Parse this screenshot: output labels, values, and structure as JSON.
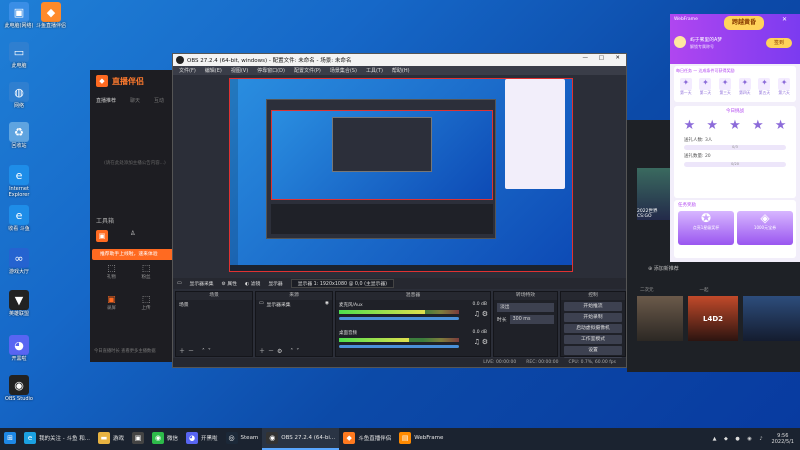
{
  "desktop_icons": [
    {
      "label": "此电脑(网络)",
      "icon": "computer-icon",
      "color": "#3a8ee6",
      "glyph": "▣"
    },
    {
      "label": "斗鱼直播伴侣",
      "icon": "app-icon",
      "color": "#ff8a2a",
      "glyph": "◆"
    },
    {
      "label": "此电脑",
      "icon": "computer-icon",
      "color": "#2f7fd0",
      "glyph": "▭"
    },
    {
      "label": "网络",
      "icon": "network-icon",
      "color": "#2f7fd0",
      "glyph": "◍"
    },
    {
      "label": "回收站",
      "icon": "recycle-bin-icon",
      "color": "#5fa4e0",
      "glyph": "♻"
    },
    {
      "label": "Internet Explorer",
      "icon": "ie-icon",
      "color": "#1e8de8",
      "glyph": "e"
    },
    {
      "label": "收看 斗鱼",
      "icon": "ie-icon",
      "color": "#1e8de8",
      "glyph": "e"
    },
    {
      "label": "游戏大厅",
      "icon": "meta-icon",
      "color": "#2563d0",
      "glyph": "∞"
    },
    {
      "label": "英雄联盟",
      "icon": "game-icon",
      "color": "#222222",
      "glyph": "▼"
    },
    {
      "label": "开黑啦",
      "icon": "discord-icon",
      "color": "#5865f2",
      "glyph": "◕"
    },
    {
      "label": "OBS Studio",
      "icon": "obs-icon",
      "color": "#222222",
      "glyph": "◉"
    }
  ],
  "live_app": {
    "brand": "直播伴侣",
    "tabs": [
      "直播推荐",
      "聊天",
      "互动"
    ],
    "notice": "(请在此处添加主播公告内容...)",
    "tools_label": "工具箱",
    "hint": "推荐助手上线啦，速来体验",
    "tool_rows": [
      [
        "礼物",
        "粉丝",
        "管理"
      ],
      [
        "录屏",
        "上传",
        "更多"
      ]
    ],
    "bottom_tools": [
      "助播",
      "弹幕",
      "连麦"
    ],
    "footer": "今日直播时长  查看更多主播数据"
  },
  "webframe": {
    "title": "WebFrame",
    "tab_icon": "跨越黄昏",
    "streamer": "屿于雾里的A梦",
    "sub": "解锁专属称号",
    "checkin": "签到",
    "progress_label": "每日任务 — 达成条件可获得奖励",
    "days": [
      "第一天",
      "第二天",
      "第三天",
      "第四天",
      "第五天",
      "第六天"
    ],
    "section2": "今日挑战",
    "task1": "送礼人数: 3人",
    "task1_progress": "0/3",
    "task2": "送礼数量: 20",
    "task2_progress": "0/20",
    "gift_label": "任务奖励",
    "reward1": "点亮1星级奖杯",
    "reward2": "1000元宝券",
    "bottom_games": [
      "二次元",
      "一起"
    ],
    "add_banner": "添加新推荐",
    "game_card": "2022世界 CS:GO"
  },
  "obs": {
    "title": "OBS 27.2.4 (64-bit, windows) - 配置文件: 未命名 - 场景: 未命名",
    "menu": [
      "文件(F)",
      "编辑(E)",
      "视图(V)",
      "停靠窗口(D)",
      "配置文件(P)",
      "场景集合(S)",
      "工具(T)",
      "帮助(H)"
    ],
    "source_bar": {
      "source": "显示器采集",
      "props": "属性",
      "filter": "滤镜",
      "display": "显示器",
      "display_value": "显示器 1: 1920x1080 @ 0,0 (主显示器)"
    },
    "docks": {
      "scenes": "场景",
      "sources": "来源",
      "mixer": "混音器",
      "transitions": "转场特效",
      "controls": "控制"
    },
    "scene_items": [
      "场景"
    ],
    "source_items": [
      "显示器采集"
    ],
    "mixer_channels": [
      {
        "name": "麦克风/Aux",
        "db": "0.0 dB",
        "level": 0.72
      },
      {
        "name": "桌面音频",
        "db": "0.0 dB",
        "level": 0.58
      }
    ],
    "transition": {
      "type": "淡出",
      "duration_label": "时长",
      "duration": "300 ms"
    },
    "controls": [
      "开始推流",
      "开始录制",
      "启动虚拟摄像机",
      "工作室模式",
      "设置",
      "退出"
    ],
    "status": {
      "live": "LIVE: 00:00:00",
      "rec": "REC: 00:00:00",
      "cpu": "CPU: 0.7%, 60.00 fps"
    }
  },
  "taskbar": {
    "items": [
      {
        "label": "",
        "icon": "start-icon",
        "color": "#1e88e5",
        "glyph": "⊞"
      },
      {
        "label": "我的关注 - 斗鱼 和...",
        "icon": "edge-icon",
        "color": "#1ba1e2",
        "glyph": "e"
      },
      {
        "label": "游戏",
        "icon": "folder-icon",
        "color": "#e8b341",
        "glyph": "▬"
      },
      {
        "label": "",
        "icon": "store-icon",
        "color": "#444",
        "glyph": "▣"
      },
      {
        "label": "微信",
        "icon": "wechat-icon",
        "color": "#2dbb4a",
        "glyph": "◉"
      },
      {
        "label": "开黑啦",
        "icon": "kook-icon",
        "color": "#5865f2",
        "glyph": "◕"
      },
      {
        "label": "Steam",
        "icon": "steam-icon",
        "color": "#1b2838",
        "glyph": "◎"
      },
      {
        "label": "OBS 27.2.4 (64-bi...",
        "icon": "obs-icon",
        "color": "#333",
        "glyph": "◉",
        "active": true
      },
      {
        "label": "斗鱼直播伴侣",
        "icon": "douyu-icon",
        "color": "#ff7a1f",
        "glyph": "◆"
      },
      {
        "label": "WebFrame",
        "icon": "webframe-icon",
        "color": "#ff8a00",
        "glyph": "▤"
      }
    ],
    "time": "9:56",
    "date": "2022/5/1"
  }
}
